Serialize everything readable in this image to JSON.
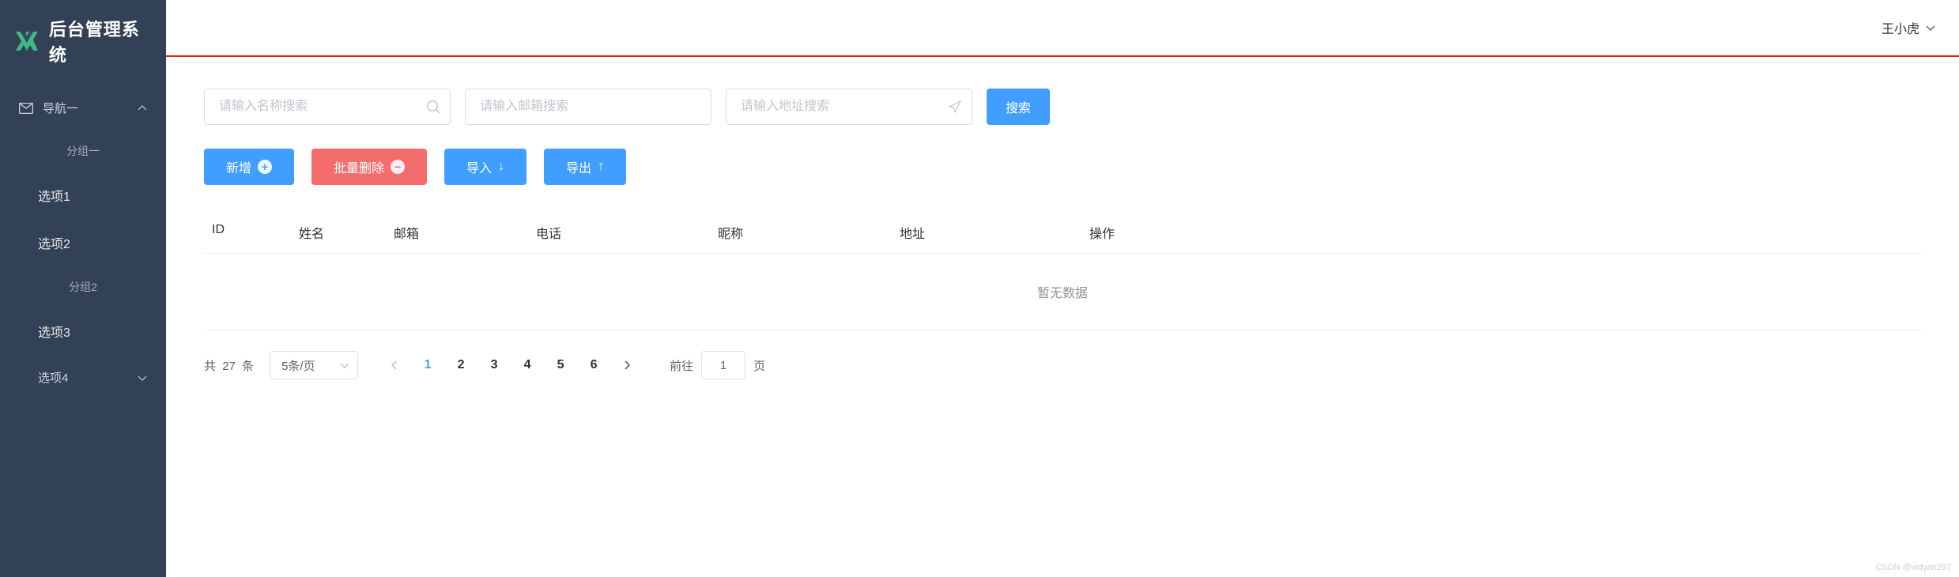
{
  "header": {
    "title": "后台管理系统",
    "user_name": "王小虎"
  },
  "sidebar": {
    "groups": [
      {
        "label": "导航一",
        "expanded": true,
        "subgroups": [
          {
            "label": "分组一",
            "items": [
              {
                "label": "选项1"
              },
              {
                "label": "选项2"
              }
            ]
          },
          {
            "label": "分组2",
            "items": [
              {
                "label": "选项3"
              },
              {
                "label": "选项4"
              }
            ]
          }
        ]
      }
    ]
  },
  "search": {
    "name_placeholder": "请输入名称搜索",
    "email_placeholder": "请输入邮箱搜索",
    "address_placeholder": "请输入地址搜索",
    "button": "搜索"
  },
  "actions": {
    "add": "新增",
    "batch_delete": "批量删除",
    "import": "导入",
    "export": "导出"
  },
  "table": {
    "columns": {
      "id": "ID",
      "name": "姓名",
      "email": "邮箱",
      "phone": "电话",
      "nick": "昵称",
      "addr": "地址",
      "op": "操作"
    },
    "empty_text": "暂无数据"
  },
  "pagination": {
    "total_prefix": "共",
    "total_count": "27",
    "total_suffix": "条",
    "page_size_label": "5条/页",
    "pages": [
      "1",
      "2",
      "3",
      "4",
      "5",
      "6"
    ],
    "current_page": 1,
    "jump_prefix": "前往",
    "jump_value": "1",
    "jump_suffix": "页"
  },
  "watermark": "CSDN @wdyan297"
}
